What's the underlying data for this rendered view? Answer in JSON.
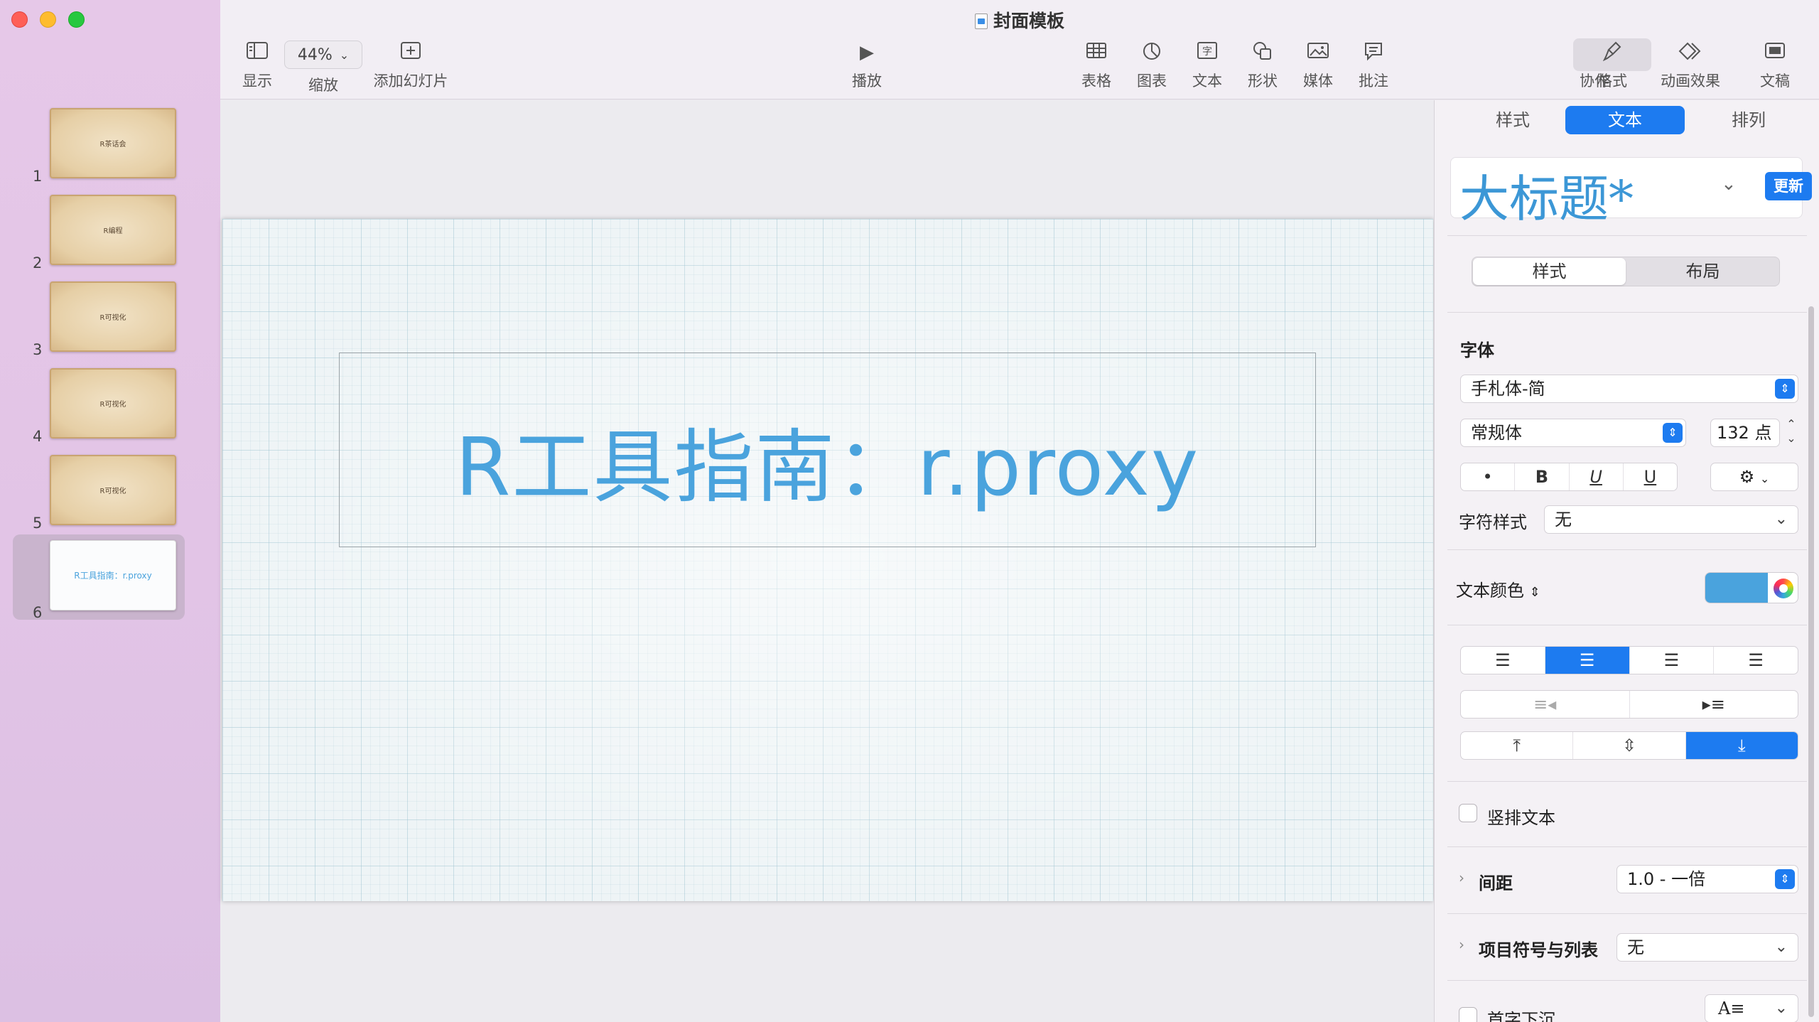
{
  "window": {
    "title": "封面模板"
  },
  "toolbar": {
    "view_label": "显示",
    "zoom_value": "44%",
    "zoom_label": "缩放",
    "add_slide_label": "添加幻灯片",
    "play_label": "播放",
    "table_label": "表格",
    "chart_label": "图表",
    "text_label": "文本",
    "shape_label": "形状",
    "media_label": "媒体",
    "comment_label": "批注",
    "collaborate_label": "协作",
    "format_label": "格式",
    "animate_label": "动画效果",
    "document_label": "文稿"
  },
  "slides": [
    {
      "number": "1",
      "thumb_text": "R茶话会"
    },
    {
      "number": "2",
      "thumb_text": "R编程"
    },
    {
      "number": "3",
      "thumb_text": "R可视化"
    },
    {
      "number": "4",
      "thumb_text": "R可视化"
    },
    {
      "number": "5",
      "thumb_text": "R可视化"
    },
    {
      "number": "6",
      "thumb_text": "R工具指南：r.proxy"
    }
  ],
  "slide_canvas": {
    "title_text": "R工具指南：r.proxy",
    "title_color": "#4aa3dd"
  },
  "inspector": {
    "tabs": [
      "样式",
      "文本",
      "排列"
    ],
    "active_tab": "文本",
    "paragraph_style": "大标题*",
    "update_label": "更新",
    "subtabs": [
      "样式",
      "布局"
    ],
    "font_section": "字体",
    "font_family": "手札体-简",
    "font_typeface": "常规体",
    "font_size": "132 点",
    "char_style_label": "字符样式",
    "char_style_value": "无",
    "text_color_label": "文本颜色",
    "text_color": "#4aa3dd",
    "vertical_text_label": "竖排文本",
    "spacing_label": "间距",
    "spacing_value": "1.0 - 一倍",
    "bullets_label": "项目符号与列表",
    "bullets_value": "无",
    "dropcap_label": "首字下沉"
  },
  "colors": {
    "accent": "#1d7bf0",
    "sidebar": "#e4c6e7"
  }
}
